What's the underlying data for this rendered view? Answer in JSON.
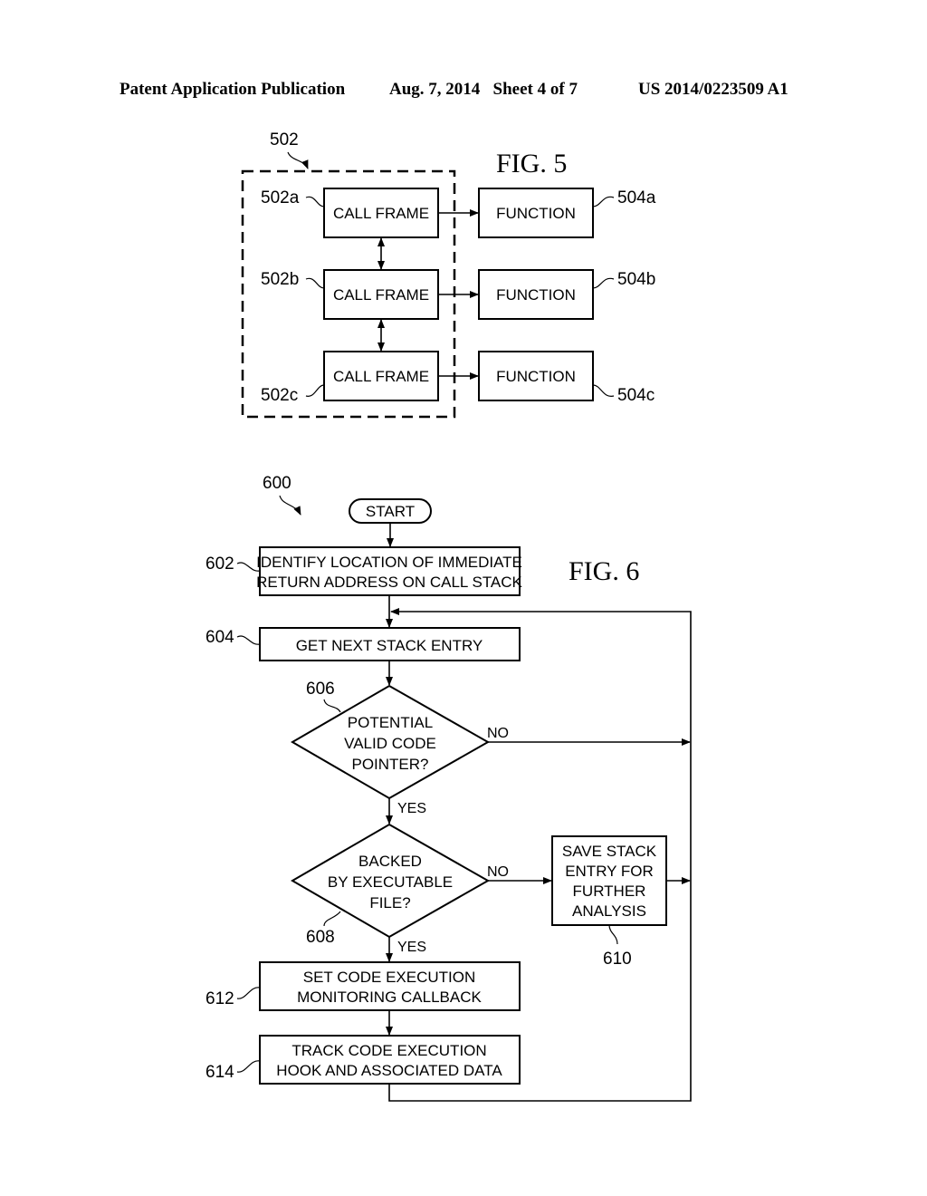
{
  "header": {
    "publication": "Patent Application Publication",
    "date_sheet": "Aug. 7, 2014   Sheet 4 of 7",
    "number": "US 2014/0223509 A1"
  },
  "fig5": {
    "title": "FIG. 5",
    "group_ref": "502",
    "call_frames": [
      {
        "ref": "502a",
        "label": "CALL FRAME"
      },
      {
        "ref": "502b",
        "label": "CALL FRAME"
      },
      {
        "ref": "502c",
        "label": "CALL FRAME"
      }
    ],
    "functions": [
      {
        "ref": "504a",
        "label": "FUNCTION"
      },
      {
        "ref": "504b",
        "label": "FUNCTION"
      },
      {
        "ref": "504c",
        "label": "FUNCTION"
      }
    ]
  },
  "fig6": {
    "title": "FIG. 6",
    "ref": "600",
    "start": "START",
    "steps": {
      "s602": {
        "ref": "602",
        "lines": [
          "IDENTIFY LOCATION OF IMMEDIATE",
          "RETURN ADDRESS ON CALL STACK"
        ]
      },
      "s604": {
        "ref": "604",
        "lines": [
          "GET NEXT STACK ENTRY"
        ]
      },
      "s606": {
        "ref": "606",
        "lines": [
          "POTENTIAL",
          "VALID CODE",
          "POINTER?"
        ]
      },
      "s608": {
        "ref": "608",
        "lines": [
          "BACKED",
          "BY EXECUTABLE",
          "FILE?"
        ]
      },
      "s610": {
        "ref": "610",
        "lines": [
          "SAVE STACK",
          "ENTRY FOR",
          "FURTHER",
          "ANALYSIS"
        ]
      },
      "s612": {
        "ref": "612",
        "lines": [
          "SET CODE EXECUTION",
          "MONITORING CALLBACK"
        ]
      },
      "s614": {
        "ref": "614",
        "lines": [
          "TRACK CODE EXECUTION",
          "HOOK AND ASSOCIATED DATA"
        ]
      }
    },
    "yes": "YES",
    "no": "NO"
  }
}
